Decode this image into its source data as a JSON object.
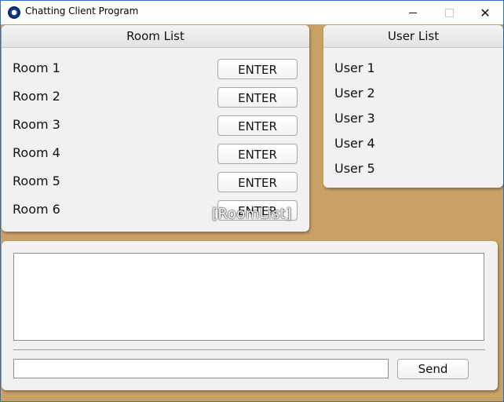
{
  "window": {
    "title": "Chatting Client Program",
    "controls": {
      "minimize": "minimize",
      "maximize": "maximize",
      "close": "✕"
    }
  },
  "room_panel": {
    "title": "Room List",
    "rooms": [
      {
        "label": "Room 1",
        "button": "ENTER"
      },
      {
        "label": "Room 2",
        "button": "ENTER"
      },
      {
        "label": "Room 3",
        "button": "ENTER"
      },
      {
        "label": "Room 4",
        "button": "ENTER"
      },
      {
        "label": "Room 5",
        "button": "ENTER"
      },
      {
        "label": "Room 6",
        "button": "ENTER"
      }
    ],
    "overlay_caption": "[RoomList]"
  },
  "user_panel": {
    "title": "User List",
    "users": [
      "User 1",
      "User 2",
      "User 3",
      "User 4",
      "User 5"
    ]
  },
  "chat_panel": {
    "message_value": "",
    "send_label": "Send"
  },
  "colors": {
    "background": "#c9a066",
    "panel": "#f1f1f1",
    "window_border": "#2b72c8"
  }
}
